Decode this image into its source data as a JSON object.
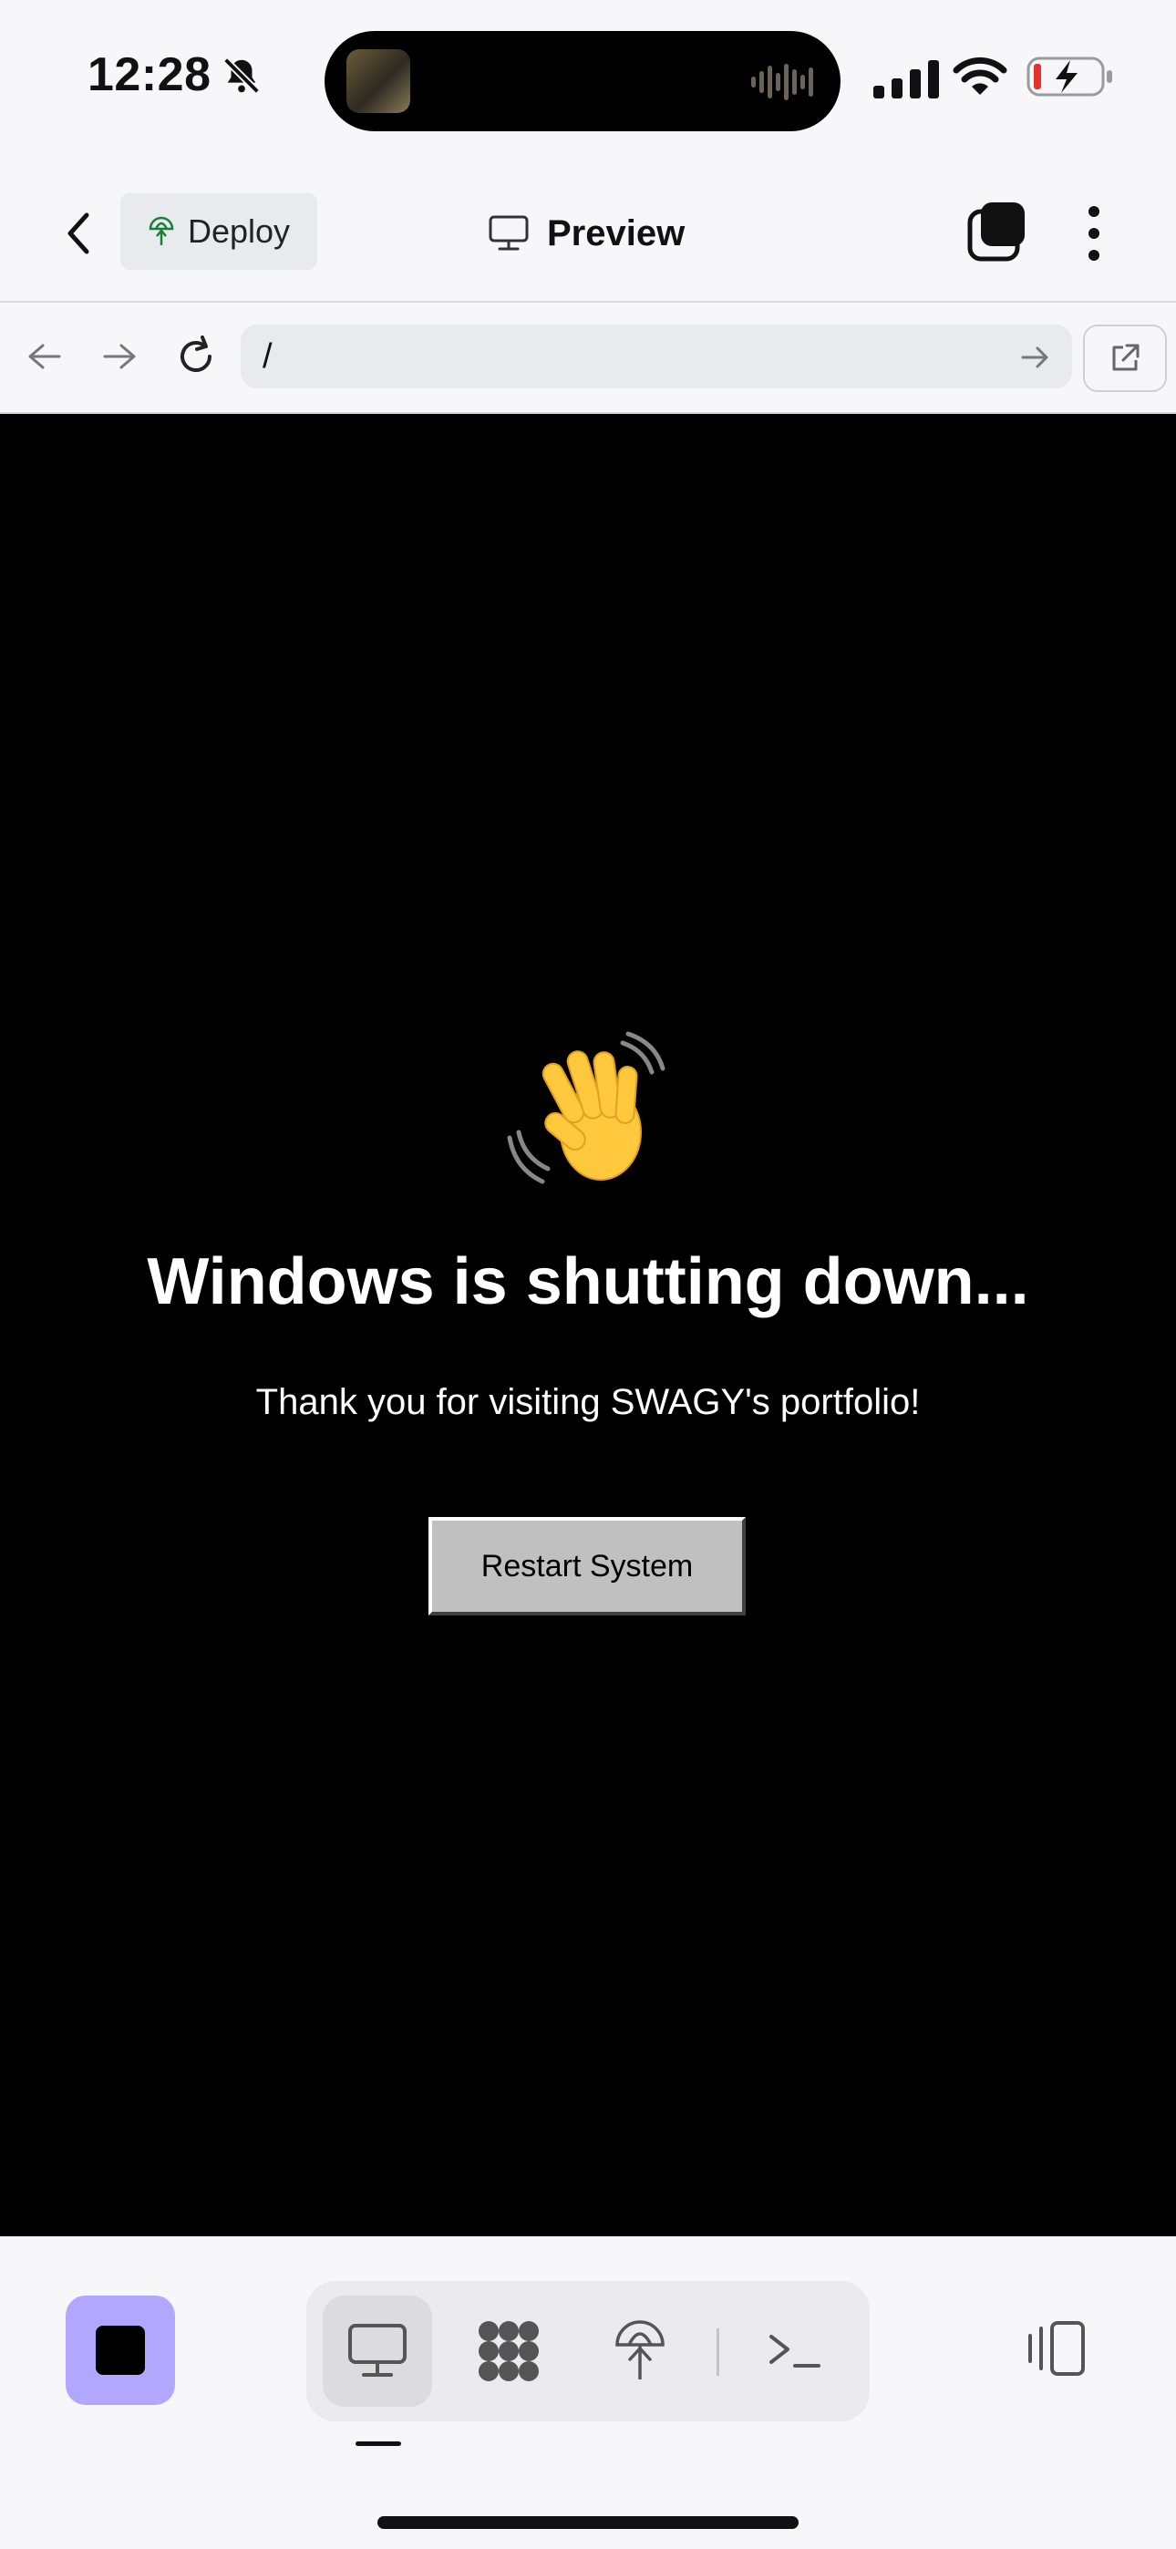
{
  "status_bar": {
    "time": "12:28"
  },
  "toolbar": {
    "deploy_label": "Deploy",
    "title": "Preview"
  },
  "url_bar": {
    "path": "/"
  },
  "page": {
    "emoji": "👋",
    "title": "Windows is shutting down...",
    "subtitle": "Thank you for visiting SWAGY's portfolio!",
    "restart_label": "Restart System"
  },
  "colors": {
    "viewport_bg": "#000000",
    "stop_button": "#b2a7ff",
    "deploy_icon": "#1a7f37",
    "battery_low": "#e5322d"
  },
  "bottom_bar": {
    "tabs": [
      {
        "icon": "monitor-icon",
        "active": true
      },
      {
        "icon": "apps-grid-icon",
        "active": false
      },
      {
        "icon": "deploy-icon",
        "active": false
      },
      {
        "icon": "terminal-icon",
        "active": false
      }
    ]
  }
}
